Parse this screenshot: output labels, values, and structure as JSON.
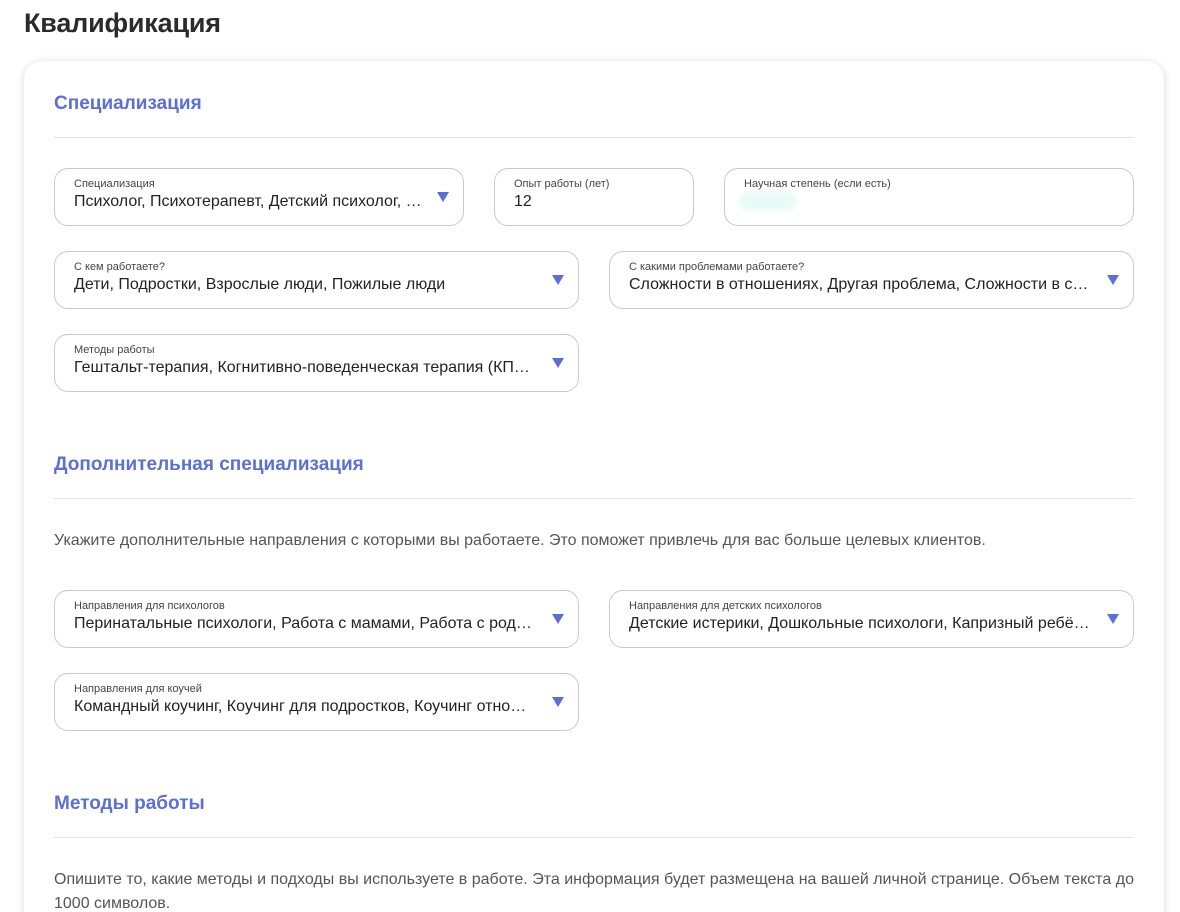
{
  "page": {
    "title": "Квалификация"
  },
  "specialization": {
    "title": "Специализация",
    "fields": {
      "specialization": {
        "label": "Специализация",
        "value": "Психолог, Психотерапевт, Детский психолог, Коуч"
      },
      "experience": {
        "label": "Опыт работы (лет)",
        "value": "12"
      },
      "degree": {
        "label": "Научная степень (если есть)",
        "value": ""
      },
      "clients": {
        "label": "С кем работаете?",
        "value": "Дети, Подростки, Взрослые люди, Пожилые люди"
      },
      "problems": {
        "label": "С какими проблемами работаете?",
        "value": "Сложности в отношениях, Другая проблема, Сложности в семье"
      },
      "methods": {
        "label": "Методы работы",
        "value": "Гештальт-терапия, Когнитивно-поведенческая терапия (КПТ), Психоанализ"
      }
    }
  },
  "additional": {
    "title": "Дополнительная специализация",
    "description": "Укажите дополнительные направления с которыми вы работаете. Это поможет привлечь для вас больше целевых клиентов.",
    "fields": {
      "psychologists": {
        "label": "Направления для психологов",
        "value": "Перинатальные психологи, Работа с мамами, Работа с родителями"
      },
      "child_psychologists": {
        "label": "Направления для детских психологов",
        "value": "Детские истерики, Дошкольные психологи, Капризный ребёнок"
      },
      "coaches": {
        "label": "Направления для коучей",
        "value": "Командный коучинг, Коучинг для подростков, Коучинг отношений"
      }
    }
  },
  "work_methods": {
    "title": "Методы работы",
    "description": "Опишите то, какие методы и подходы вы используете в работе. Эта информация будет размещена на вашей личной странице. Объем текста до 1000 символов."
  },
  "colors": {
    "accent": "#5b6fd6",
    "border": "#c9c9c9",
    "divider": "#e3e3e3"
  },
  "icons": {
    "dropdown": "triangle-down-icon"
  }
}
